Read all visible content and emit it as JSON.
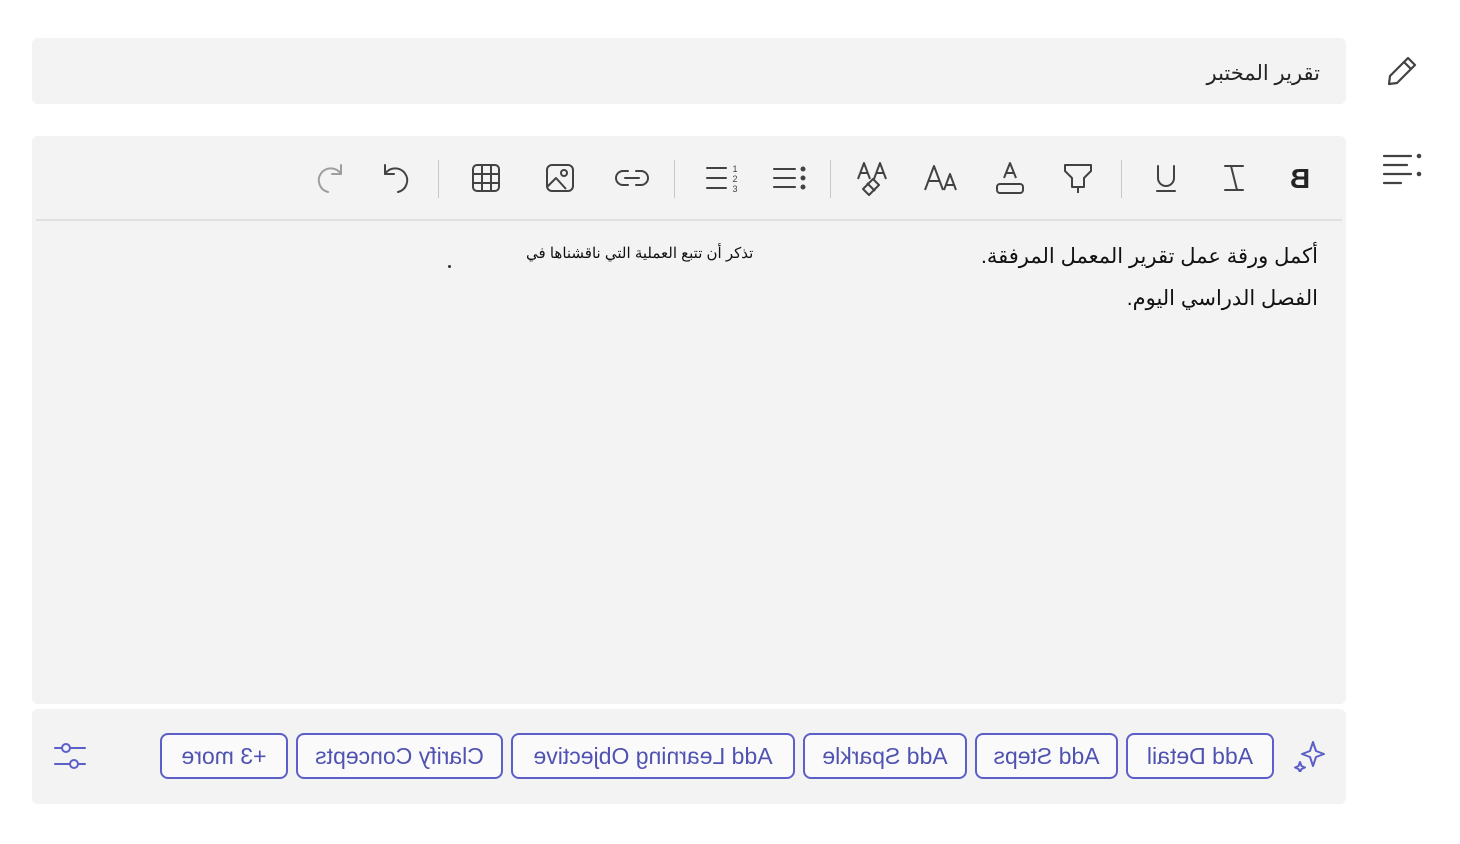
{
  "title": "تقرير المختبر",
  "editor": {
    "body": "أكمل ورقة عمل تقرير المعمل المرفقة. الفصل الدراسي اليوم.",
    "hint": "تذكر أن تتبع العملية التي ناقشناها في"
  },
  "toolbar": {
    "items": [
      "bold-icon",
      "italic-icon",
      "underline-icon",
      "highlight-icon",
      "font-color-icon",
      "font-size-icon",
      "clear-format-icon",
      "bullet-list-icon",
      "numbered-list-icon",
      "link-icon",
      "image-icon",
      "table-icon",
      "redo-icon",
      "undo-icon"
    ]
  },
  "suggestions": {
    "chips": [
      "Add Detail",
      "Add Steps",
      "Add Sparkle",
      "Add Learning Objective",
      "Clarify Concepts",
      "+3 more"
    ]
  },
  "colors": {
    "accent": "#5b5fc7",
    "panel": "#f3f3f3"
  }
}
